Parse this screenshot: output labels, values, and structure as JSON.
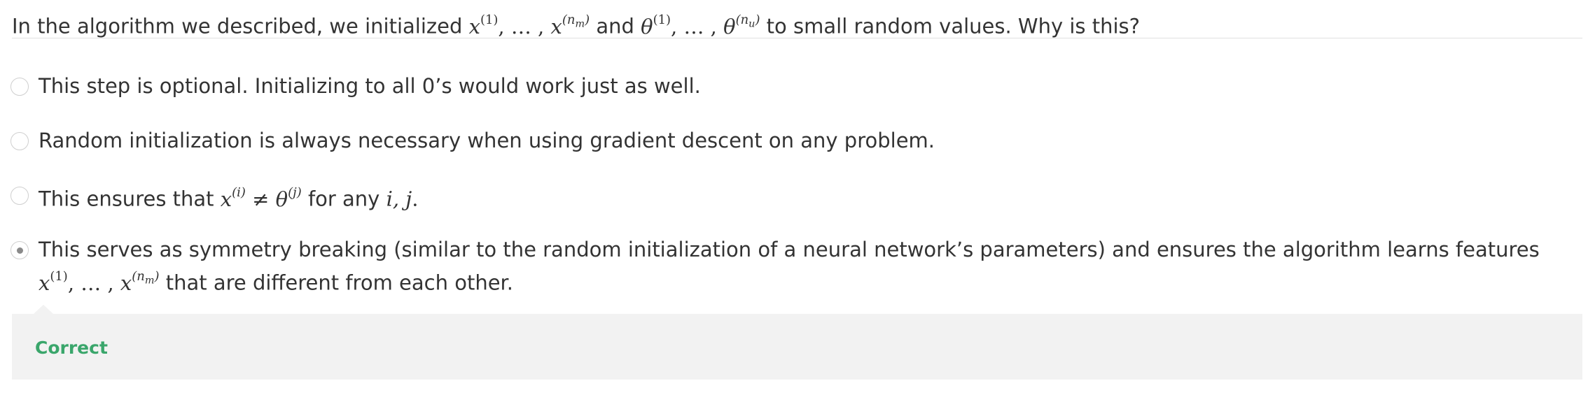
{
  "question": {
    "text_before": "In the algorithm we described, we initialized",
    "math_1": "x(1), … , x(nm)",
    "text_mid": "and",
    "math_2": "θ(1), … , θ(nu)",
    "text_after": "to small random values. Why is this?"
  },
  "options": [
    {
      "text": "This step is optional. Initializing to all 0’s would work just as well.",
      "selected": false
    },
    {
      "text": "Random initialization is always necessary when using gradient descent on any problem.",
      "selected": false
    },
    {
      "text_before": "This ensures that",
      "math_1": "x(i) ≠ θ(j)",
      "text_mid": "for any",
      "math_2": "i, j.",
      "selected": false
    },
    {
      "text_before": "This serves as symmetry breaking (similar to the random initialization of a neural network’s parameters) and ensures the algorithm learns features",
      "math_1": "x(1), … , x(nm)",
      "text_after": "that are different from each other.",
      "selected": true
    }
  ],
  "feedback": {
    "label": "Correct",
    "color": "#3aa66b"
  }
}
